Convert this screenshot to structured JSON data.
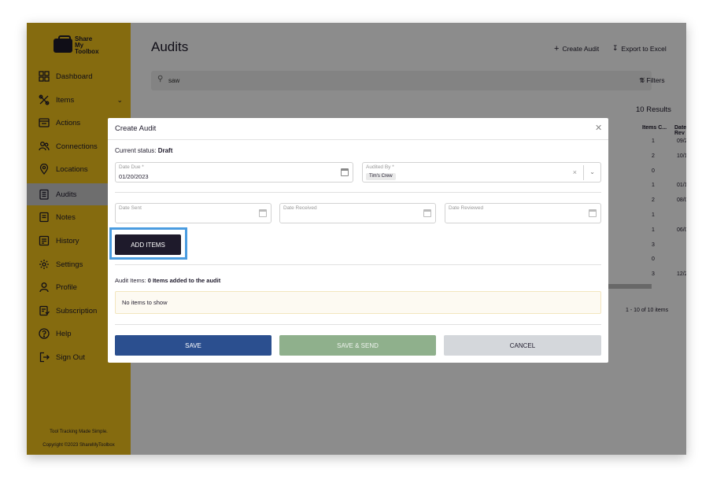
{
  "brand": {
    "logo_text": "Share\nMy\nToolbox",
    "tagline": "Tool Tracking Made Simple.",
    "copyright": "Copyright ©2023 ShareMyToolbox"
  },
  "sidebar": {
    "items": [
      {
        "label": "Dashboard",
        "icon": "grid-icon"
      },
      {
        "label": "Items",
        "icon": "tools-icon"
      },
      {
        "label": "Actions",
        "icon": "actions-icon"
      },
      {
        "label": "Connections",
        "icon": "people-icon"
      },
      {
        "label": "Locations",
        "icon": "location-pin-icon"
      },
      {
        "label": "Audits",
        "icon": "clipboard-icon"
      },
      {
        "label": "Notes",
        "icon": "notes-icon"
      },
      {
        "label": "History",
        "icon": "history-icon"
      },
      {
        "label": "Settings",
        "icon": "gear-icon"
      },
      {
        "label": "Profile",
        "icon": "user-icon"
      },
      {
        "label": "Subscription",
        "icon": "subscription-icon"
      },
      {
        "label": "Help",
        "icon": "help-icon"
      },
      {
        "label": "Sign Out",
        "icon": "sign-out-icon"
      }
    ],
    "active": "Audits"
  },
  "header": {
    "title": "Audits",
    "create_label": "Create Audit",
    "export_label": "Export to Excel"
  },
  "search": {
    "value": "saw",
    "filters_label": "Filters"
  },
  "results": {
    "count_label": "10 Results",
    "columns": [
      "Items C...",
      "Date Rev"
    ],
    "items_counts": [
      "1",
      "2",
      "0",
      "1",
      "2",
      "1",
      "1",
      "3",
      "0",
      "3"
    ],
    "dates": [
      "09/20/:",
      "10/18/:",
      "-",
      "01/18/:",
      "08/06/:",
      "-",
      "06/02/:",
      "-",
      "-",
      "12/22/:"
    ],
    "pager": "1 - 10 of 10 items"
  },
  "modal": {
    "title": "Create Audit",
    "status_label": "Current status:",
    "status_value": "Draft",
    "date_due_label": "Date Due *",
    "date_due_value": "01/20/2023",
    "audited_by_label": "Audited By *",
    "audited_by_value": "Tim's Crew",
    "date_sent_label": "Date Sent",
    "date_received_label": "Date Received",
    "date_reviewed_label": "Date Reviewed",
    "add_items_label": "ADD ITEMS",
    "audit_items_label": "Audit Items:",
    "audit_items_count": "0 Items added to the audit",
    "empty_text": "No items to show",
    "save_label": "SAVE",
    "save_send_label": "SAVE & SEND",
    "cancel_label": "CANCEL"
  },
  "colors": {
    "sidebar_bg": "#f3c31c",
    "brand_dark": "#1e1a2b",
    "save_blue": "#2b4f8f",
    "save_send_green": "#8fb08c",
    "highlight": "#4a9ce0"
  }
}
